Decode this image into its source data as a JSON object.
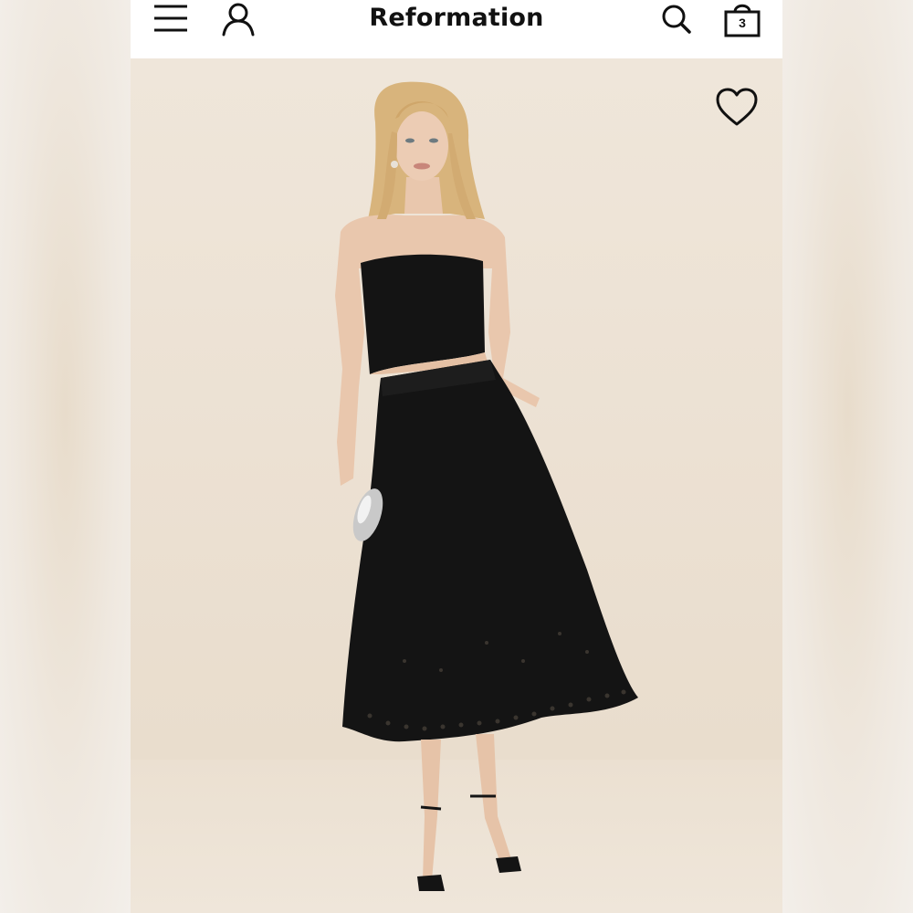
{
  "header": {
    "brand": "Reformation",
    "icons": {
      "menu": "hamburger-menu-icon",
      "account": "user-account-icon",
      "search": "search-icon",
      "bag": "shopping-bag-icon"
    },
    "bag_count": "3"
  },
  "product": {
    "image_icon": "wishlist-heart-icon",
    "colors": {
      "backdrop": "#ece1d3",
      "garment": "#141414",
      "skin": "#e9c7ad",
      "hair": "#d8b47c"
    }
  }
}
